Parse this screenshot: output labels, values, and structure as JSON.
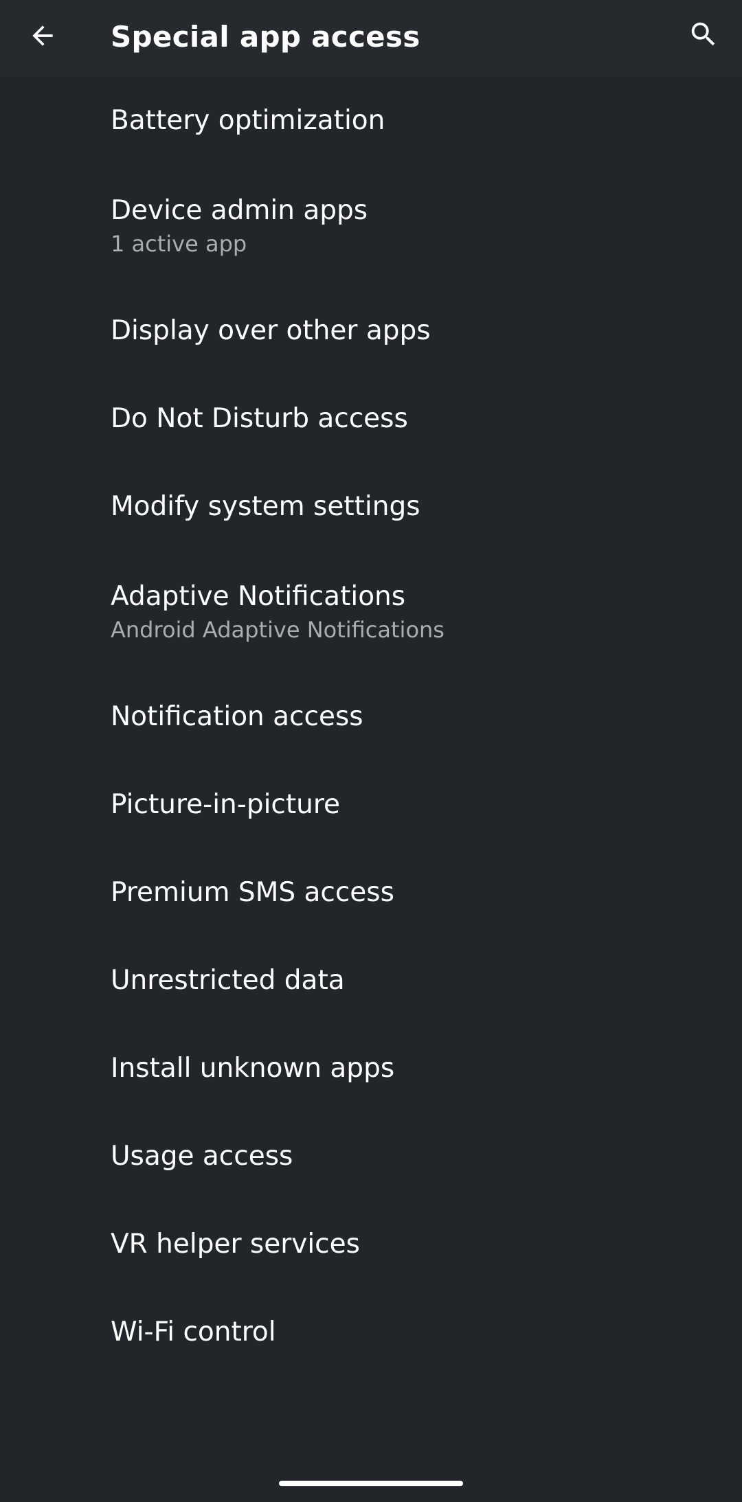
{
  "appbar": {
    "title": "Special app access",
    "back_icon": "arrow-left-icon",
    "search_icon": "search-icon"
  },
  "items": [
    {
      "label": "Battery optimization"
    },
    {
      "label": "Device admin apps",
      "subtitle": "1 active app"
    },
    {
      "label": "Display over other apps"
    },
    {
      "label": "Do Not Disturb access"
    },
    {
      "label": "Modify system settings"
    },
    {
      "label": "Adaptive Notifications",
      "subtitle": "Android Adaptive Notifications"
    },
    {
      "label": "Notification access"
    },
    {
      "label": "Picture-in-picture"
    },
    {
      "label": "Premium SMS access"
    },
    {
      "label": "Unrestricted data"
    },
    {
      "label": "Install unknown apps"
    },
    {
      "label": "Usage access"
    },
    {
      "label": "VR helper services"
    },
    {
      "label": "Wi-Fi control"
    }
  ],
  "colors": {
    "background": "#22262a",
    "appbar": "#262a2e",
    "primary_text": "#ffffff",
    "secondary_text": "#a9adb1"
  }
}
